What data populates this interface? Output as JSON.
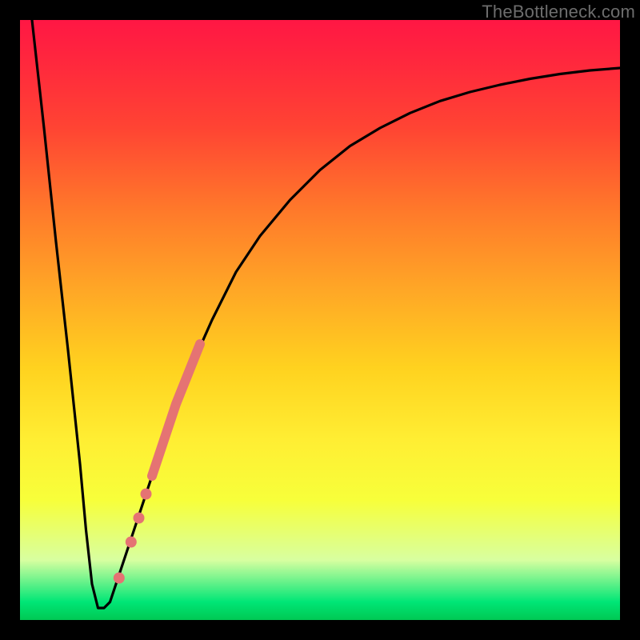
{
  "watermark": "TheBottleneck.com",
  "chart_data": {
    "type": "line",
    "title": "",
    "xlabel": "",
    "ylabel": "",
    "xlim": [
      0,
      100
    ],
    "ylim": [
      0,
      100
    ],
    "grid": false,
    "legend": false,
    "series": [
      {
        "name": "bottleneck-curve",
        "color": "#000000",
        "x": [
          2,
          4,
          6,
          8,
          10,
          11,
          12,
          13,
          14,
          15,
          16,
          18,
          20,
          22,
          25,
          28,
          32,
          36,
          40,
          45,
          50,
          55,
          60,
          65,
          70,
          75,
          80,
          85,
          90,
          95,
          100
        ],
        "y": [
          100,
          82,
          63,
          45,
          26,
          15,
          6,
          2,
          2,
          3,
          6,
          12,
          18,
          24,
          33,
          41,
          50,
          58,
          64,
          70,
          75,
          79,
          82,
          84.5,
          86.5,
          88,
          89.2,
          90.2,
          91,
          91.6,
          92
        ]
      },
      {
        "name": "highlight-segment",
        "color": "#e57373",
        "stroke_width": 12,
        "x": [
          22,
          24,
          26,
          28,
          30
        ],
        "y": [
          24,
          30,
          36,
          41,
          46
        ]
      },
      {
        "name": "highlight-dots",
        "color": "#e57373",
        "type": "scatter",
        "marker_radius_px": 7,
        "x": [
          16.5,
          18.5,
          19.8,
          21
        ],
        "y": [
          7,
          13,
          17,
          21
        ]
      }
    ],
    "background_gradient": {
      "direction": "vertical",
      "stops": [
        {
          "pos": 0.0,
          "color": "#ff1744"
        },
        {
          "pos": 0.45,
          "color": "#ffa726"
        },
        {
          "pos": 0.7,
          "color": "#ffee33"
        },
        {
          "pos": 0.97,
          "color": "#00e676"
        },
        {
          "pos": 1.0,
          "color": "#00c853"
        }
      ]
    }
  }
}
